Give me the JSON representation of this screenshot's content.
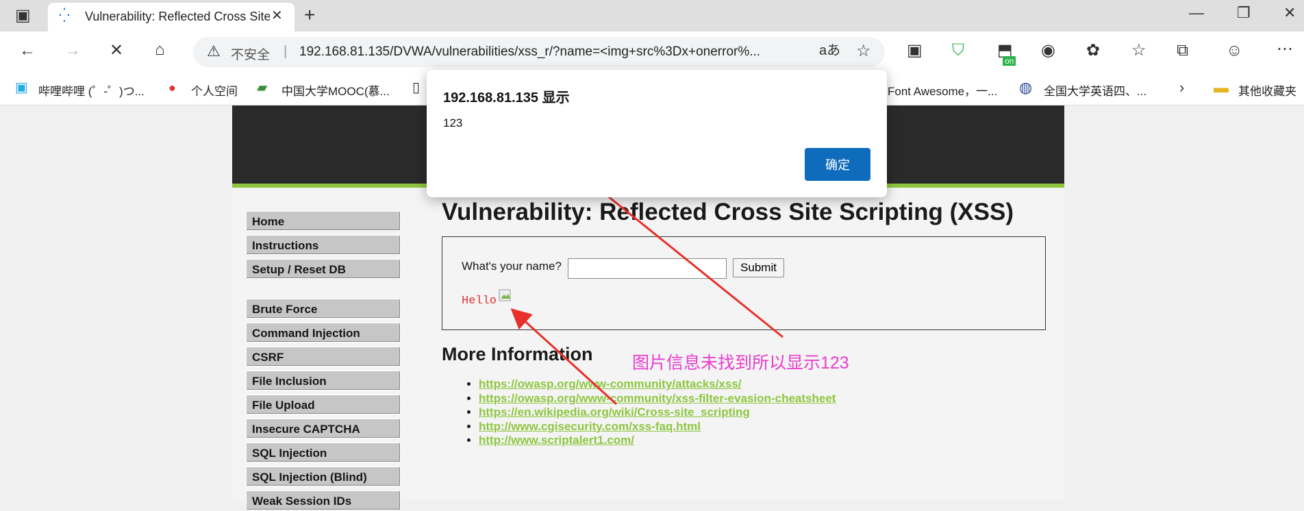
{
  "browser": {
    "tab_title": "Vulnerability: Reflected Cross Site Scripting (XSS) :: Damn Vulnerable Web Application (DVWA)",
    "security_label": "不安全",
    "url": "192.168.81.135/DVWA/vulnerabilities/xss_r/?name=<img+src%3Dx+onerror%...",
    "ext_badge": "on",
    "bookmarks": [
      "哔哩哔哩 (゜-゜)つ...",
      "个人空间",
      "中国大学MOOC(慕...",
      "Font Awesome，一...",
      "全国大学英语四、...",
      "其他收藏夹"
    ]
  },
  "dialog": {
    "title": "192.168.81.135 显示",
    "message": "123",
    "ok_label": "确定"
  },
  "menu": {
    "items": [
      "Home",
      "Instructions",
      "Setup / Reset DB",
      "Brute Force",
      "Command Injection",
      "CSRF",
      "File Inclusion",
      "File Upload",
      "Insecure CAPTCHA",
      "SQL Injection",
      "SQL Injection (Blind)",
      "Weak Session IDs"
    ]
  },
  "main": {
    "title": "Vulnerability: Reflected Cross Site Scripting (XSS)",
    "form_label": "What's your name?",
    "submit_label": "Submit",
    "hello_text": "Hello",
    "more_info_title": "More Information",
    "links": [
      "https://owasp.org/www-community/attacks/xss/",
      "https://owasp.org/www-community/xss-filter-evasion-cheatsheet",
      "https://en.wikipedia.org/wiki/Cross-site_scripting",
      "http://www.cgisecurity.com/xss-faq.html",
      "http://www.scriptalert1.com/"
    ]
  },
  "annotation": {
    "text": "图片信息未找到所以显示123",
    "color": "#e83ccf",
    "arrow_color": "#e8302a"
  }
}
